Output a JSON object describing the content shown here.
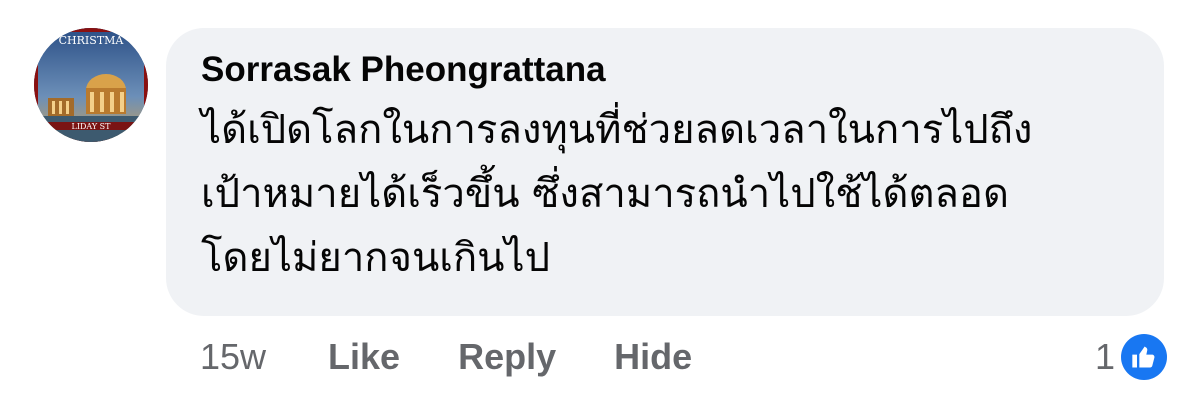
{
  "comment": {
    "author": "Sorrasak Pheongrattana",
    "text_lines": [
      "ได้เปิดโลกในการลงทุนที่ช่วยลดเวลาในการไปถึง",
      "เป้าหมายได้เร็วขึ้น ซึ่งสามารถนำไปใช้ได้ตลอด",
      "โดยไม่ยากจนเกินไป"
    ],
    "avatar_text_top": "CHRISTMA",
    "avatar_text_bottom": "LIDAY ST"
  },
  "actions": {
    "time": "15w",
    "like_label": "Like",
    "reply_label": "Reply",
    "hide_label": "Hide"
  },
  "reactions": {
    "count": "1",
    "icon": "thumbs-up-icon",
    "color": "#1877f2"
  },
  "colors": {
    "bubble": "#f0f2f5",
    "text": "#050505",
    "muted": "#65676b"
  }
}
